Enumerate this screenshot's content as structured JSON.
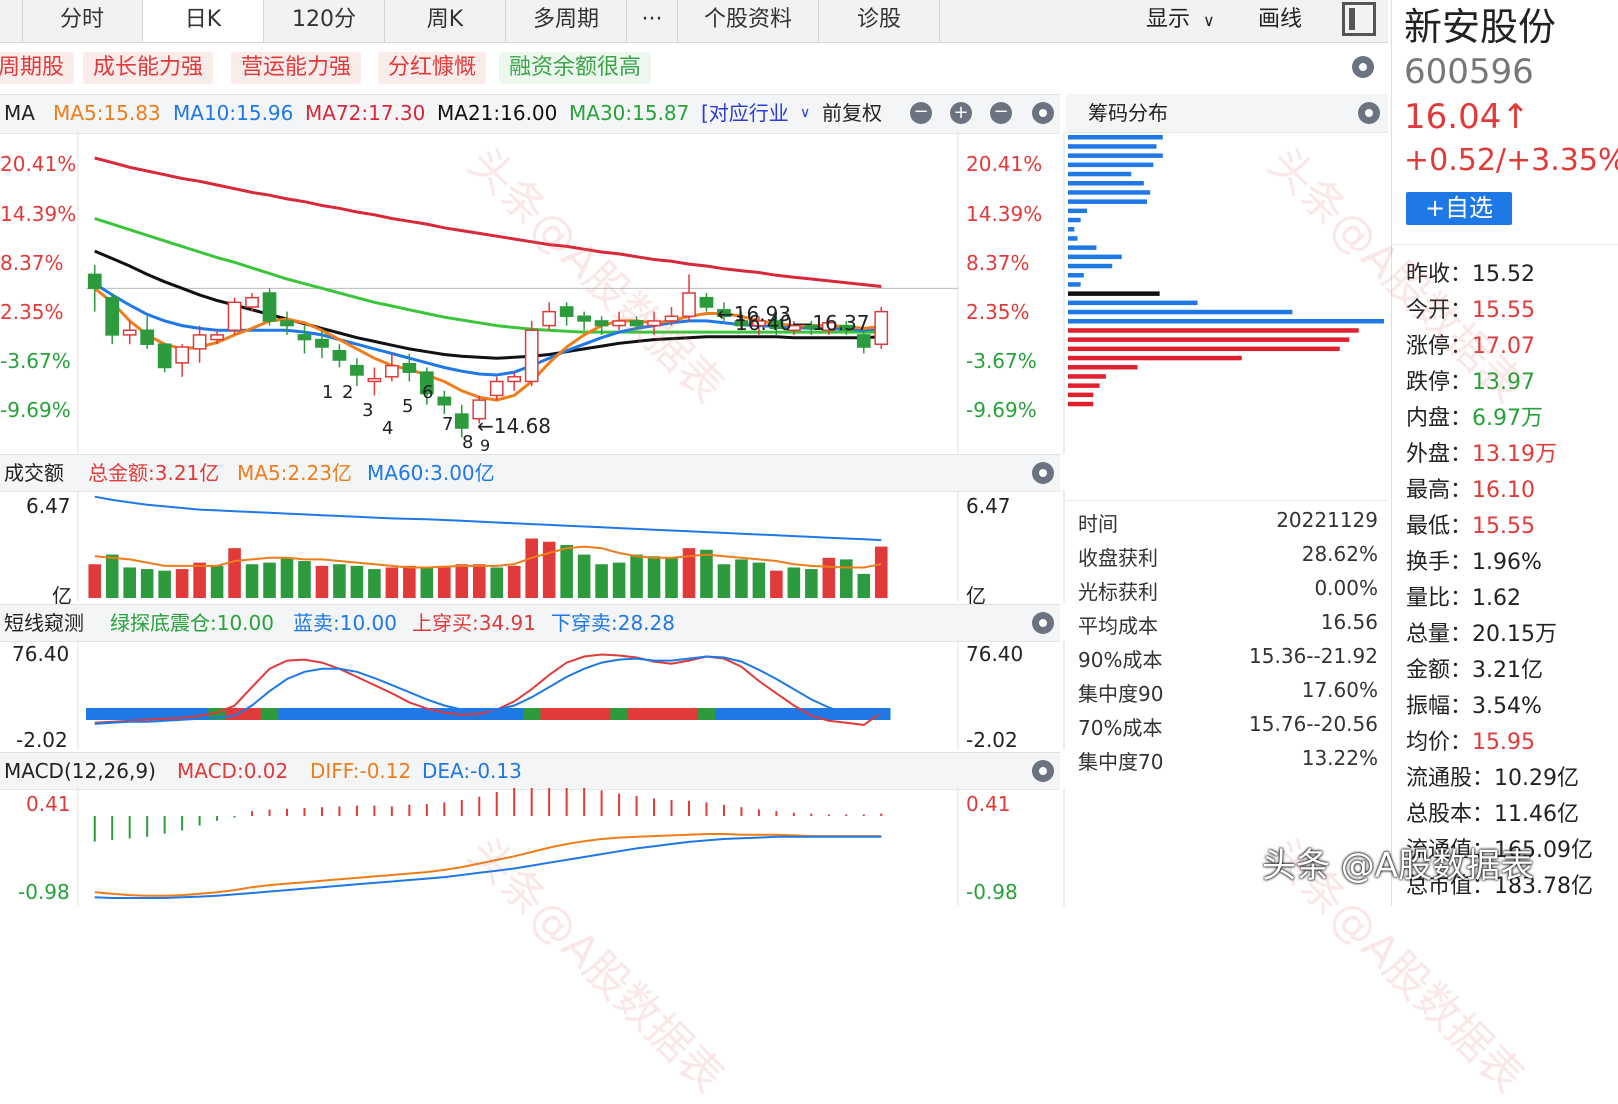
{
  "tabs": [
    "分时",
    "日K",
    "120分",
    "周K",
    "多周期",
    "···",
    "个股资料",
    "诊股"
  ],
  "active_tab": "日K",
  "toolbar": {
    "display": "显示",
    "draw": "画线"
  },
  "tags": [
    "周期股",
    "成长能力强",
    "营运能力强",
    "分红慷慨",
    "融资余额很高"
  ],
  "kline": {
    "ma_label": "MA",
    "ma5": "MA5:15.83",
    "ma10": "MA10:15.96",
    "ma72": "MA72:17.30",
    "ma21": "MA21:16.00",
    "ma30": "MA30:15.87",
    "industry": "[对应行业",
    "adjust": "前复权",
    "y_labels": [
      "20.41%",
      "14.39%",
      "8.37%",
      "2.35%",
      "-3.67%",
      "-9.69%"
    ],
    "y_labels_left": [
      "20.41%",
      "14.39%",
      "8.37%",
      "2.35%",
      "-3.67%",
      "-9.69%"
    ],
    "annot_high": "←16.93",
    "annot_range": "16.40—16.37",
    "annot_low": "←14.68",
    "counts": [
      "1",
      "2",
      "3",
      "4",
      "5",
      "6",
      "7",
      "8",
      "9"
    ]
  },
  "chip": {
    "title": "筹码分布",
    "rows": [
      {
        "k": "时间",
        "v": "20221129"
      },
      {
        "k": "收盘获利",
        "v": "28.62%"
      },
      {
        "k": "光标获利",
        "v": "0.00%"
      },
      {
        "k": "平均成本",
        "v": "16.56"
      },
      {
        "k": "90%成本",
        "v": "15.36--21.92"
      },
      {
        "k": "集中度90",
        "v": "17.60%"
      },
      {
        "k": "70%成本",
        "v": "15.76--20.56"
      },
      {
        "k": "集中度70",
        "v": "13.22%"
      }
    ]
  },
  "volume": {
    "title": "成交额",
    "total": "总金额:3.21亿",
    "ma5": "MA5:2.23亿",
    "ma60": "MA60:3.00亿",
    "ytop": "6.47",
    "unit": "亿"
  },
  "short": {
    "title": "短线窥测",
    "green": "绿探底震仓:10.00",
    "blue": "蓝卖:10.00",
    "upcross": "上穿买:34.91",
    "downcross": "下穿卖:28.28",
    "ytop": "76.40",
    "ybottom": "-2.02"
  },
  "macd": {
    "title": "MACD(12,26,9)",
    "macd": "MACD:0.02",
    "diff": "DIFF:-0.12",
    "dea": "DEA:-0.13",
    "ytop": "0.41",
    "ybottom": "-0.98"
  },
  "stock": {
    "name": "新安股份",
    "code": "600596",
    "price": "16.04↑",
    "change": "+0.52/+3.35%",
    "watch_button": "+自选"
  },
  "quote": [
    {
      "k": "昨收：",
      "v": "15.52",
      "c": "#222"
    },
    {
      "k": "今开：",
      "v": "15.55",
      "c": "#e03a3a"
    },
    {
      "k": "涨停：",
      "v": "17.07",
      "c": "#e03a3a"
    },
    {
      "k": "跌停：",
      "v": "13.97",
      "c": "#27a13a"
    },
    {
      "k": "内盘：",
      "v": "6.97万",
      "c": "#27a13a"
    },
    {
      "k": "外盘：",
      "v": "13.19万",
      "c": "#e03a3a"
    },
    {
      "k": "最高：",
      "v": "16.10",
      "c": "#e03a3a"
    },
    {
      "k": "最低：",
      "v": "15.55",
      "c": "#e03a3a"
    },
    {
      "k": "换手：",
      "v": "1.96%",
      "c": "#222"
    },
    {
      "k": "量比：",
      "v": "1.62",
      "c": "#222"
    },
    {
      "k": "总量：",
      "v": "20.15万",
      "c": "#222"
    },
    {
      "k": "金额：",
      "v": "3.21亿",
      "c": "#222"
    },
    {
      "k": "振幅：",
      "v": "3.54%",
      "c": "#222"
    },
    {
      "k": "均价：",
      "v": "15.95",
      "c": "#e03a3a"
    },
    {
      "k": "流通股：",
      "v": "10.29亿",
      "c": "#222"
    },
    {
      "k": "总股本：",
      "v": "11.46亿",
      "c": "#222"
    },
    {
      "k": "流通值：",
      "v": "165.09亿",
      "c": "#222"
    },
    {
      "k": "总市值：",
      "v": "183.78亿",
      "c": "#222"
    }
  ],
  "watermark_text": "头条@A股数据表",
  "colors": {
    "up": "#e03a3a",
    "down": "#2e9a3e",
    "blue": "#1e78e6",
    "orange": "#ef7d1a",
    "black": "#111",
    "green": "#3cc43c",
    "red": "#d8283a"
  },
  "chart_data": {
    "type": "line",
    "candles": [
      {
        "o": 15.7,
        "c": 15.55,
        "h": 15.8,
        "l": 15.3
      },
      {
        "o": 15.45,
        "c": 15.05,
        "h": 15.5,
        "l": 14.95
      },
      {
        "o": 15.05,
        "c": 15.1,
        "h": 15.2,
        "l": 14.95
      },
      {
        "o": 15.1,
        "c": 14.95,
        "h": 15.25,
        "l": 14.9
      },
      {
        "o": 14.95,
        "c": 14.7,
        "h": 14.95,
        "l": 14.65
      },
      {
        "o": 14.75,
        "c": 14.92,
        "h": 14.95,
        "l": 14.6
      },
      {
        "o": 14.9,
        "c": 15.05,
        "h": 15.15,
        "l": 14.75
      },
      {
        "o": 15.0,
        "c": 15.05,
        "h": 15.1,
        "l": 14.95
      },
      {
        "o": 15.1,
        "c": 15.4,
        "h": 15.45,
        "l": 15.05
      },
      {
        "o": 15.35,
        "c": 15.45,
        "h": 15.5,
        "l": 15.3
      },
      {
        "o": 15.5,
        "c": 15.2,
        "h": 15.55,
        "l": 15.15
      },
      {
        "o": 15.2,
        "c": 15.15,
        "h": 15.3,
        "l": 15.05
      },
      {
        "o": 15.05,
        "c": 15.0,
        "h": 15.15,
        "l": 14.85
      },
      {
        "o": 15.0,
        "c": 14.92,
        "h": 15.1,
        "l": 14.8
      },
      {
        "o": 14.88,
        "c": 14.78,
        "h": 14.95,
        "l": 14.7
      },
      {
        "o": 14.72,
        "c": 14.62,
        "h": 14.8,
        "l": 14.5
      },
      {
        "o": 14.55,
        "c": 14.58,
        "h": 14.7,
        "l": 14.4
      },
      {
        "o": 14.6,
        "c": 14.72,
        "h": 14.85,
        "l": 14.55
      },
      {
        "o": 14.74,
        "c": 14.65,
        "h": 14.85,
        "l": 14.55
      },
      {
        "o": 14.65,
        "c": 14.42,
        "h": 14.7,
        "l": 14.3
      },
      {
        "o": 14.38,
        "c": 14.3,
        "h": 14.45,
        "l": 14.2
      },
      {
        "o": 14.2,
        "c": 14.05,
        "h": 14.3,
        "l": 13.95
      },
      {
        "o": 14.15,
        "c": 14.35,
        "h": 14.4,
        "l": 14.1
      },
      {
        "o": 14.4,
        "c": 14.55,
        "h": 14.6,
        "l": 14.35
      },
      {
        "o": 14.55,
        "c": 14.6,
        "h": 14.65,
        "l": 14.45
      },
      {
        "o": 14.55,
        "c": 15.1,
        "h": 15.2,
        "l": 14.5
      },
      {
        "o": 15.15,
        "c": 15.3,
        "h": 15.4,
        "l": 15.1
      },
      {
        "o": 15.35,
        "c": 15.25,
        "h": 15.4,
        "l": 15.15
      },
      {
        "o": 15.25,
        "c": 15.2,
        "h": 15.3,
        "l": 15.1
      },
      {
        "o": 15.2,
        "c": 15.15,
        "h": 15.25,
        "l": 15.05
      },
      {
        "o": 15.15,
        "c": 15.2,
        "h": 15.3,
        "l": 15.1
      },
      {
        "o": 15.2,
        "c": 15.15,
        "h": 15.25,
        "l": 15.1
      },
      {
        "o": 15.15,
        "c": 15.2,
        "h": 15.3,
        "l": 15.05
      },
      {
        "o": 15.2,
        "c": 15.25,
        "h": 15.35,
        "l": 15.15
      },
      {
        "o": 15.25,
        "c": 15.5,
        "h": 15.7,
        "l": 15.2
      },
      {
        "o": 15.45,
        "c": 15.35,
        "h": 15.5,
        "l": 15.3
      },
      {
        "o": 15.32,
        "c": 15.25,
        "h": 15.4,
        "l": 15.2
      },
      {
        "o": 15.2,
        "c": 15.15,
        "h": 15.3,
        "l": 15.1
      },
      {
        "o": 15.15,
        "c": 15.2,
        "h": 15.25,
        "l": 15.05
      },
      {
        "o": 15.2,
        "c": 15.12,
        "h": 15.25,
        "l": 15.05
      },
      {
        "o": 15.1,
        "c": 15.15,
        "h": 15.2,
        "l": 15.05
      },
      {
        "o": 15.15,
        "c": 15.12,
        "h": 15.2,
        "l": 15.05
      },
      {
        "o": 15.1,
        "c": 15.18,
        "h": 15.25,
        "l": 15.05
      },
      {
        "o": 15.15,
        "c": 15.1,
        "h": 15.2,
        "l": 15.05
      },
      {
        "o": 15.05,
        "c": 14.92,
        "h": 15.1,
        "l": 14.85
      },
      {
        "o": 14.95,
        "c": 15.3,
        "h": 15.35,
        "l": 14.9
      }
    ],
    "ma72": [
      16.95,
      16.9,
      16.85,
      16.81,
      16.77,
      16.73,
      16.7,
      16.66,
      16.62,
      16.58,
      16.55,
      16.51,
      16.48,
      16.44,
      16.41,
      16.37,
      16.34,
      16.3,
      16.27,
      16.24,
      16.2,
      16.17,
      16.14,
      16.11,
      16.08,
      16.05,
      16.02,
      16.0,
      15.97,
      15.94,
      15.92,
      15.89,
      15.86,
      15.84,
      15.81,
      15.79,
      15.76,
      15.74,
      15.72,
      15.69,
      15.67,
      15.65,
      15.63,
      15.61,
      15.59,
      15.57
    ],
    "ma30": [
      16.3,
      16.24,
      16.18,
      16.12,
      16.06,
      16.0,
      15.94,
      15.88,
      15.83,
      15.77,
      15.71,
      15.65,
      15.6,
      15.55,
      15.5,
      15.45,
      15.4,
      15.36,
      15.32,
      15.28,
      15.24,
      15.21,
      15.18,
      15.15,
      15.13,
      15.11,
      15.1,
      15.09,
      15.08,
      15.08,
      15.08,
      15.08,
      15.08,
      15.08,
      15.08,
      15.08,
      15.08,
      15.08,
      15.08,
      15.08,
      15.08,
      15.08,
      15.08,
      15.08,
      15.08,
      15.08
    ],
    "ma21": [
      15.95,
      15.87,
      15.79,
      15.7,
      15.62,
      15.55,
      15.48,
      15.42,
      15.37,
      15.32,
      15.27,
      15.22,
      15.17,
      15.12,
      15.07,
      15.02,
      14.98,
      14.94,
      14.9,
      14.87,
      14.84,
      14.82,
      14.81,
      14.8,
      14.81,
      14.82,
      14.84,
      14.87,
      14.9,
      14.93,
      14.96,
      14.98,
      15.0,
      15.01,
      15.02,
      15.03,
      15.03,
      15.03,
      15.03,
      15.03,
      15.02,
      15.02,
      15.02,
      15.02,
      15.02,
      15.03
    ],
    "ma10": [
      15.6,
      15.48,
      15.37,
      15.27,
      15.2,
      15.15,
      15.12,
      15.1,
      15.1,
      15.1,
      15.1,
      15.1,
      15.08,
      15.05,
      15.0,
      14.95,
      14.9,
      14.85,
      14.8,
      14.75,
      14.7,
      14.66,
      14.63,
      14.62,
      14.65,
      14.72,
      14.8,
      14.88,
      14.95,
      15.02,
      15.08,
      15.12,
      15.15,
      15.18,
      15.2,
      15.2,
      15.18,
      15.16,
      15.15,
      15.14,
      15.13,
      15.12,
      15.12,
      15.11,
      15.1,
      15.12
    ],
    "ma5": [
      15.55,
      15.4,
      15.2,
      15.05,
      14.95,
      14.9,
      14.92,
      14.97,
      15.05,
      15.12,
      15.2,
      15.22,
      15.18,
      15.1,
      15.0,
      14.9,
      14.8,
      14.72,
      14.68,
      14.62,
      14.55,
      14.45,
      14.38,
      14.35,
      14.4,
      14.55,
      14.75,
      14.92,
      15.05,
      15.15,
      15.2,
      15.2,
      15.18,
      15.2,
      15.25,
      15.28,
      15.28,
      15.25,
      15.2,
      15.17,
      15.15,
      15.15,
      15.15,
      15.14,
      15.12,
      15.14
    ],
    "y_range": [
      13.9,
      17.1
    ],
    "volume": {
      "values": [
        2.1,
        2.7,
        1.9,
        1.8,
        1.7,
        1.8,
        2.2,
        2.0,
        3.1,
        2.1,
        2.2,
        2.5,
        2.3,
        2.0,
        2.1,
        2.0,
        1.8,
        1.9,
        2.0,
        1.9,
        2.0,
        2.1,
        2.1,
        1.9,
        2.0,
        3.7,
        3.5,
        3.3,
        2.7,
        2.1,
        2.2,
        2.7,
        2.6,
        2.5,
        3.1,
        3.0,
        2.1,
        2.4,
        2.2,
        1.7,
        1.9,
        1.8,
        2.5,
        2.4,
        1.5,
        3.2
      ],
      "up": [
        1,
        0,
        0,
        0,
        0,
        1,
        1,
        0,
        1,
        0,
        0,
        0,
        0,
        1,
        0,
        0,
        0,
        1,
        1,
        0,
        1,
        1,
        1,
        0,
        1,
        1,
        1,
        0,
        0,
        0,
        0,
        0,
        0,
        0,
        1,
        0,
        0,
        0,
        0,
        1,
        0,
        0,
        1,
        0,
        0,
        1
      ],
      "ma60": [
        6.3,
        6.1,
        5.95,
        5.8,
        5.7,
        5.6,
        5.5,
        5.45,
        5.4,
        5.35,
        5.3,
        5.25,
        5.2,
        5.15,
        5.1,
        5.05,
        5.0,
        4.95,
        4.92,
        4.9,
        4.85,
        4.8,
        4.75,
        4.7,
        4.65,
        4.6,
        4.55,
        4.5,
        4.45,
        4.4,
        4.35,
        4.3,
        4.25,
        4.2,
        4.15,
        4.1,
        4.05,
        4.0,
        3.95,
        3.9,
        3.85,
        3.8,
        3.75,
        3.7,
        3.65,
        3.6
      ],
      "ma5": [
        2.6,
        2.5,
        2.4,
        2.2,
        2.0,
        2.0,
        2.0,
        2.0,
        2.3,
        2.4,
        2.5,
        2.5,
        2.4,
        2.4,
        2.3,
        2.2,
        2.1,
        2.0,
        1.9,
        1.9,
        1.95,
        2.0,
        2.0,
        2.0,
        2.1,
        2.5,
        2.8,
        3.1,
        3.2,
        3.1,
        2.8,
        2.6,
        2.5,
        2.5,
        2.6,
        2.7,
        2.6,
        2.5,
        2.4,
        2.3,
        2.1,
        2.0,
        1.95,
        1.9,
        1.9,
        2.1
      ],
      "ymax": 6.47
    },
    "short": {
      "red": [
        5,
        6,
        7,
        8,
        9,
        10,
        12,
        15,
        22,
        40,
        58,
        66,
        67,
        64,
        58,
        50,
        42,
        34,
        25,
        19,
        15,
        13,
        14,
        18,
        26,
        38,
        52,
        64,
        70,
        72,
        71,
        69,
        65,
        63,
        66,
        70,
        68,
        60,
        46,
        34,
        22,
        12,
        7,
        5,
        3,
        15
      ],
      "blue": [
        4,
        5,
        6,
        6,
        7,
        8,
        9,
        10,
        12,
        22,
        36,
        48,
        55,
        58,
        58,
        55,
        49,
        42,
        35,
        28,
        22,
        18,
        17,
        18,
        22,
        30,
        40,
        50,
        58,
        64,
        67,
        68,
        66,
        66,
        68,
        70,
        69,
        65,
        57,
        48,
        38,
        28,
        20,
        14,
        10,
        15
      ],
      "ymin": -2.02,
      "ymax": 76.4,
      "segments": [
        "blue",
        "blue",
        "blue",
        "blue",
        "blue",
        "blue",
        "blue",
        "green",
        "red",
        "red",
        "green",
        "blue",
        "blue",
        "blue",
        "blue",
        "blue",
        "blue",
        "blue",
        "blue",
        "blue",
        "blue",
        "blue",
        "blue",
        "blue",
        "blue",
        "green",
        "red",
        "red",
        "red",
        "red",
        "green",
        "red",
        "red",
        "red",
        "red",
        "green",
        "blue",
        "blue",
        "blue",
        "blue",
        "blue",
        "blue",
        "blue",
        "blue",
        "blue",
        "blue"
      ]
    },
    "macd": {
      "hist": [
        -0.32,
        -0.3,
        -0.28,
        -0.26,
        -0.22,
        -0.18,
        -0.12,
        -0.06,
        -0.02,
        0.06,
        0.08,
        0.09,
        0.1,
        0.11,
        0.12,
        0.13,
        0.13,
        0.12,
        0.14,
        0.15,
        0.17,
        0.2,
        0.24,
        0.3,
        0.35,
        0.38,
        0.41,
        0.4,
        0.36,
        0.32,
        0.28,
        0.25,
        0.22,
        0.2,
        0.19,
        0.17,
        0.14,
        0.11,
        0.08,
        0.06,
        0.04,
        0.03,
        0.02,
        0.02,
        0.02,
        0.03
      ],
      "diff": [
        -0.9,
        -0.92,
        -0.94,
        -0.95,
        -0.95,
        -0.94,
        -0.92,
        -0.9,
        -0.87,
        -0.83,
        -0.8,
        -0.78,
        -0.76,
        -0.74,
        -0.72,
        -0.7,
        -0.68,
        -0.66,
        -0.64,
        -0.62,
        -0.59,
        -0.55,
        -0.5,
        -0.45,
        -0.4,
        -0.34,
        -0.28,
        -0.23,
        -0.19,
        -0.16,
        -0.14,
        -0.13,
        -0.12,
        -0.11,
        -0.1,
        -0.09,
        -0.09,
        -0.1,
        -0.1,
        -0.1,
        -0.11,
        -0.12,
        -0.12,
        -0.12,
        -0.12,
        -0.12
      ],
      "dea": [
        -0.97,
        -0.98,
        -0.98,
        -0.98,
        -0.98,
        -0.97,
        -0.96,
        -0.95,
        -0.93,
        -0.91,
        -0.89,
        -0.87,
        -0.85,
        -0.83,
        -0.81,
        -0.79,
        -0.77,
        -0.75,
        -0.73,
        -0.71,
        -0.69,
        -0.66,
        -0.63,
        -0.6,
        -0.57,
        -0.53,
        -0.49,
        -0.45,
        -0.41,
        -0.37,
        -0.33,
        -0.29,
        -0.26,
        -0.23,
        -0.2,
        -0.18,
        -0.16,
        -0.15,
        -0.14,
        -0.13,
        -0.13,
        -0.13,
        -0.13,
        -0.13,
        -0.13,
        -0.13
      ],
      "ymin": -0.98,
      "ymax": 0.41
    },
    "chip_bars": [
      {
        "w": 0.3,
        "c": "blue"
      },
      {
        "w": 0.28,
        "c": "blue"
      },
      {
        "w": 0.3,
        "c": "blue"
      },
      {
        "w": 0.27,
        "c": "blue"
      },
      {
        "w": 0.2,
        "c": "blue"
      },
      {
        "w": 0.24,
        "c": "blue"
      },
      {
        "w": 0.26,
        "c": "blue"
      },
      {
        "w": 0.25,
        "c": "blue"
      },
      {
        "w": 0.06,
        "c": "blue"
      },
      {
        "w": 0.04,
        "c": "blue"
      },
      {
        "w": 0.02,
        "c": "blue"
      },
      {
        "w": 0.03,
        "c": "blue"
      },
      {
        "w": 0.09,
        "c": "blue"
      },
      {
        "w": 0.17,
        "c": "blue"
      },
      {
        "w": 0.14,
        "c": "blue"
      },
      {
        "w": 0.05,
        "c": "blue"
      },
      {
        "w": 0.04,
        "c": "blue"
      },
      {
        "w": 0.29,
        "c": "black"
      },
      {
        "w": 0.41,
        "c": "blue"
      },
      {
        "w": 0.71,
        "c": "blue"
      },
      {
        "w": 1.0,
        "c": "blue"
      },
      {
        "w": 0.92,
        "c": "red"
      },
      {
        "w": 0.89,
        "c": "red"
      },
      {
        "w": 0.86,
        "c": "red"
      },
      {
        "w": 0.55,
        "c": "red"
      },
      {
        "w": 0.22,
        "c": "red"
      },
      {
        "w": 0.12,
        "c": "red"
      },
      {
        "w": 0.1,
        "c": "red"
      },
      {
        "w": 0.08,
        "c": "red"
      },
      {
        "w": 0.08,
        "c": "red"
      }
    ]
  }
}
